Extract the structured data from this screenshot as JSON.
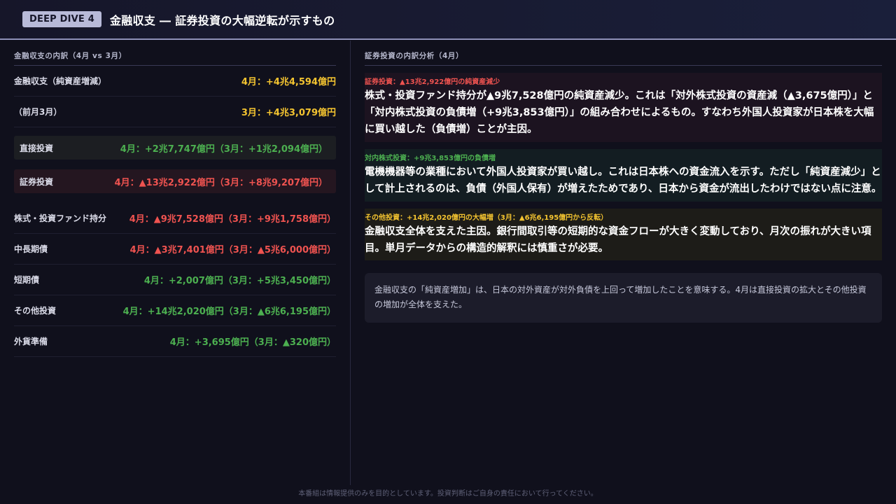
{
  "header": {
    "badge": "DEEP DIVE 4",
    "title": "金融収支 ― 証券投資の大幅逆転が示すもの"
  },
  "left": {
    "heading": "金融収支の内訳（4月 vs 3月）",
    "rows": [
      {
        "label": "金融収支（純資産増減）",
        "value": "4月：+4兆4,594億円",
        "color": "#f4c430"
      },
      {
        "label": "（前月3月）",
        "value": "3月：+4兆3,079億円",
        "color": "#f4c430"
      }
    ],
    "box_rows": [
      {
        "label": "直接投資",
        "value": "4月：+2兆7,747億円（3月：+1兆2,094億円）",
        "color": "#4caf50"
      },
      {
        "label": "証券投資",
        "value": "4月：▲13兆2,922億円（3月：+8兆9,207億円）",
        "color": "#ef5350"
      }
    ],
    "sub_rows": [
      {
        "label": "株式・投資ファンド持分",
        "value": "4月：▲9兆7,528億円（3月：+9兆1,758億円）",
        "color": "#ef5350"
      },
      {
        "label": "中長期債",
        "value": "4月：▲3兆7,401億円（3月：▲5兆6,000億円）",
        "color": "#ef5350"
      },
      {
        "label": "短期債",
        "value": "4月：+2,007億円（3月：+5兆3,450億円）",
        "color": "#4caf50"
      },
      {
        "label": "その他投資",
        "value": "4月：+14兆2,020億円（3月：▲6兆6,195億円）",
        "color": "#4caf50"
      },
      {
        "label": "外貨準備",
        "value": "4月：+3,695億円（3月：▲320億円）",
        "color": "#4caf50"
      }
    ]
  },
  "right": {
    "heading": "証券投資の内訳分析（4月）",
    "cards": [
      {
        "tag": "証券投資：▲13兆2,922億円の純資産減少",
        "tag_color": "#ef5350",
        "body": "株式・投資ファンド持分が▲9兆7,528億円の純資産減少。これは「対外株式投資の資産減（▲3,675億円）」と「対内株式投資の負債増（+9兆3,853億円）」の組み合わせによるもの。すなわち外国人投資家が日本株を大幅に買い越した（負債増）ことが主因。"
      },
      {
        "tag": "対内株式投資：+9兆3,853億円の負債増",
        "tag_color": "#4caf50",
        "body": "電機機器等の業種において外国人投資家が買い越し。これは日本株への資金流入を示す。ただし「純資産減少」として計上されるのは、負債（外国人保有）が増えたためであり、日本から資金が流出したわけではない点に注意。"
      },
      {
        "tag": "その他投資：+14兆2,020億円の大幅増（3月：▲6兆6,195億円から反転）",
        "tag_color": "#f4c430",
        "body": "金融収支全体を支えた主因。銀行間取引等の短期的な資金フローが大きく変動しており、月次の振れが大きい項目。単月データからの構造的解釈には慎重さが必要。"
      }
    ],
    "note": "金融収支の「純資産増加」は、日本の対外資産が対外負債を上回って増加したことを意味する。4月は直接投資の拡大とその他投資の増加が全体を支えた。"
  },
  "footer": "本番組は情報提供のみを目的としています。投資判断はご自身の責任において行ってください。"
}
